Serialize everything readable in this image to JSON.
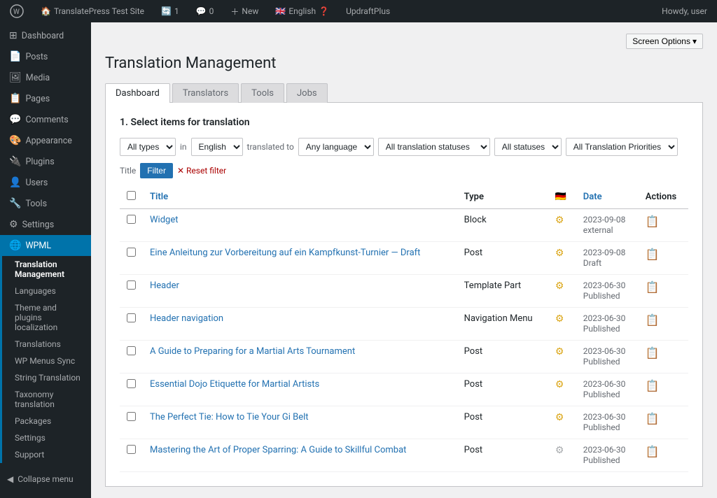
{
  "adminbar": {
    "site_name": "TranslatePress Test Site",
    "updates_count": "1",
    "comments_count": "0",
    "new_label": "New",
    "language": "English",
    "updraft": "UpdraftPlus",
    "howdy": "Howdy, user",
    "screen_options": "Screen Options"
  },
  "sidebar": {
    "items": [
      {
        "id": "dashboard",
        "label": "Dashboard",
        "icon": "⊞"
      },
      {
        "id": "posts",
        "label": "Posts",
        "icon": "📄"
      },
      {
        "id": "media",
        "label": "Media",
        "icon": "🖼"
      },
      {
        "id": "pages",
        "label": "Pages",
        "icon": "📋"
      },
      {
        "id": "comments",
        "label": "Comments",
        "icon": "💬"
      },
      {
        "id": "appearance",
        "label": "Appearance",
        "icon": "🎨"
      },
      {
        "id": "plugins",
        "label": "Plugins",
        "icon": "🔌"
      },
      {
        "id": "users",
        "label": "Users",
        "icon": "👤"
      },
      {
        "id": "tools",
        "label": "Tools",
        "icon": "🔧"
      },
      {
        "id": "settings",
        "label": "Settings",
        "icon": "⚙"
      }
    ],
    "wpml": {
      "label": "WPML",
      "active": true
    },
    "wpml_sub": [
      {
        "id": "translation-management",
        "label": "Translation Management",
        "active": true
      },
      {
        "id": "languages",
        "label": "Languages"
      },
      {
        "id": "theme-plugins",
        "label": "Theme and plugins localization"
      },
      {
        "id": "translations",
        "label": "Translations"
      },
      {
        "id": "wp-menus-sync",
        "label": "WP Menus Sync"
      },
      {
        "id": "string-translation",
        "label": "String Translation"
      },
      {
        "id": "taxonomy-translation",
        "label": "Taxonomy translation"
      },
      {
        "id": "packages",
        "label": "Packages"
      },
      {
        "id": "settings",
        "label": "Settings"
      },
      {
        "id": "support",
        "label": "Support"
      }
    ],
    "collapse": "Collapse menu"
  },
  "page": {
    "title": "Translation Management"
  },
  "tabs": [
    {
      "id": "dashboard",
      "label": "Dashboard",
      "active": true
    },
    {
      "id": "translators",
      "label": "Translators"
    },
    {
      "id": "tools",
      "label": "Tools"
    },
    {
      "id": "jobs",
      "label": "Jobs"
    }
  ],
  "section": {
    "title": "1. Select items for translation"
  },
  "filters": {
    "types_label": "All types",
    "in_label": "in",
    "language_label": "English",
    "translated_to_label": "translated to",
    "any_language_label": "Any language",
    "statuses_label": "All translation statuses",
    "all_statuses_label": "All statuses",
    "priorities_label": "All Translation Priorities",
    "filter_btn": "Filter",
    "reset_label": "Reset filter"
  },
  "table": {
    "cols": [
      {
        "id": "title",
        "label": "Title",
        "sortable": true
      },
      {
        "id": "type",
        "label": "Type"
      },
      {
        "id": "flag",
        "label": "🇩🇪"
      },
      {
        "id": "date",
        "label": "Date",
        "sortable": true
      },
      {
        "id": "actions",
        "label": "Actions"
      }
    ],
    "rows": [
      {
        "title": "Widget",
        "type": "Block",
        "status": "yellow",
        "date": "2023-09-08",
        "date_label": "external",
        "has_action": true
      },
      {
        "title": "Eine Anleitung zur Vorbereitung auf ein Kampfkunst-Turnier — Draft",
        "type": "Post",
        "status": "yellow",
        "date": "2023-09-08",
        "date_label": "Draft",
        "has_action": true
      },
      {
        "title": "Header",
        "type": "Template Part",
        "status": "yellow",
        "date": "2023-06-30",
        "date_label": "Published",
        "has_action": true
      },
      {
        "title": "Header navigation",
        "type": "Navigation Menu",
        "status": "yellow",
        "date": "2023-06-30",
        "date_label": "Published",
        "has_action": true
      },
      {
        "title": "A Guide to Preparing for a Martial Arts Tournament",
        "type": "Post",
        "status": "yellow",
        "date": "2023-06-30",
        "date_label": "Published",
        "has_action": true
      },
      {
        "title": "Essential Dojo Etiquette for Martial Artists",
        "type": "Post",
        "status": "yellow",
        "date": "2023-06-30",
        "date_label": "Published",
        "has_action": true
      },
      {
        "title": "The Perfect Tie: How to Tie Your Gi Belt",
        "type": "Post",
        "status": "yellow",
        "date": "2023-06-30",
        "date_label": "Published",
        "has_action": true
      },
      {
        "title": "Mastering the Art of Proper Sparring: A Guide to Skillful Combat",
        "type": "Post",
        "status": "grey",
        "date": "2023-06-30",
        "date_label": "Published",
        "has_action": true
      }
    ]
  }
}
